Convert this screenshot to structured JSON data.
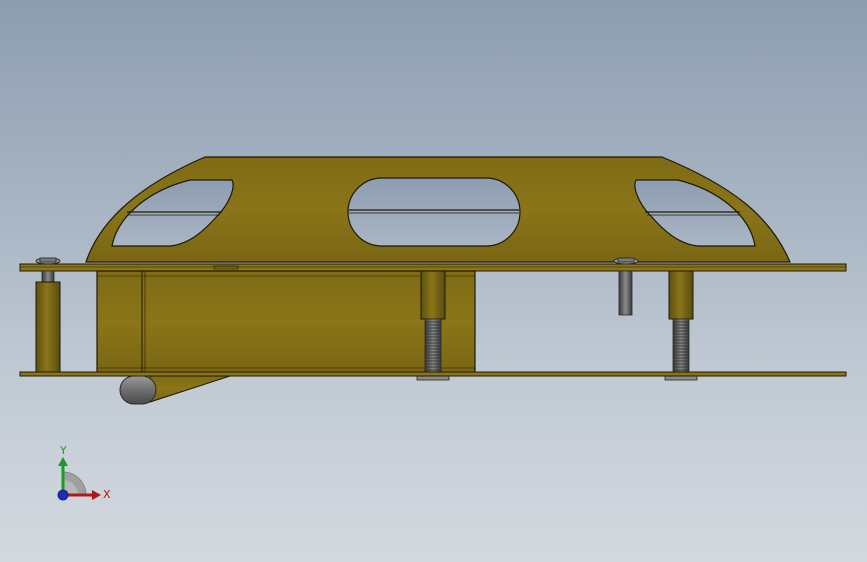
{
  "viewport": {
    "background_top": "#8d9cb0",
    "background_bottom": "#d3d9df"
  },
  "model": {
    "body_color": "#857019",
    "edge_color": "#1e1a06",
    "hardware_color": "#6b6b6b"
  },
  "triad": {
    "x_label": "X",
    "y_label": "Y",
    "x_color": "#b01818",
    "y_color": "#1b9a2a",
    "z_color": "#1a2fb8"
  }
}
